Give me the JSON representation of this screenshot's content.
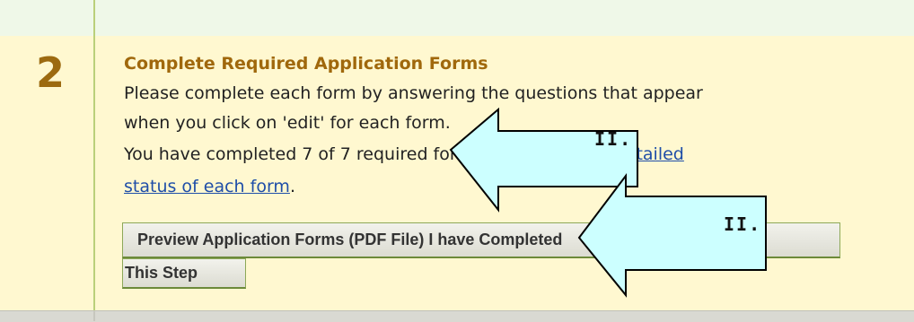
{
  "step": {
    "number": "2",
    "title": "Complete Required Application Forms",
    "line1": "Please complete each form by answering the questions that appear",
    "line2": "when you click on 'edit' for each form.",
    "line3_prefix": "You have completed 7 of 7 required forms.  See below for ",
    "line3_link": "detailed",
    "line4_link": "status of each form",
    "line4_suffix": "."
  },
  "buttons": {
    "preview": "Preview Application Forms (PDF File)                 I have Completed",
    "done": "This Step"
  },
  "arrows": [
    {
      "label": "II."
    },
    {
      "label": "II."
    }
  ],
  "colors": {
    "accent": "#a0680c",
    "arrow_fill": "#ccffff",
    "link": "#1f4ea8"
  }
}
